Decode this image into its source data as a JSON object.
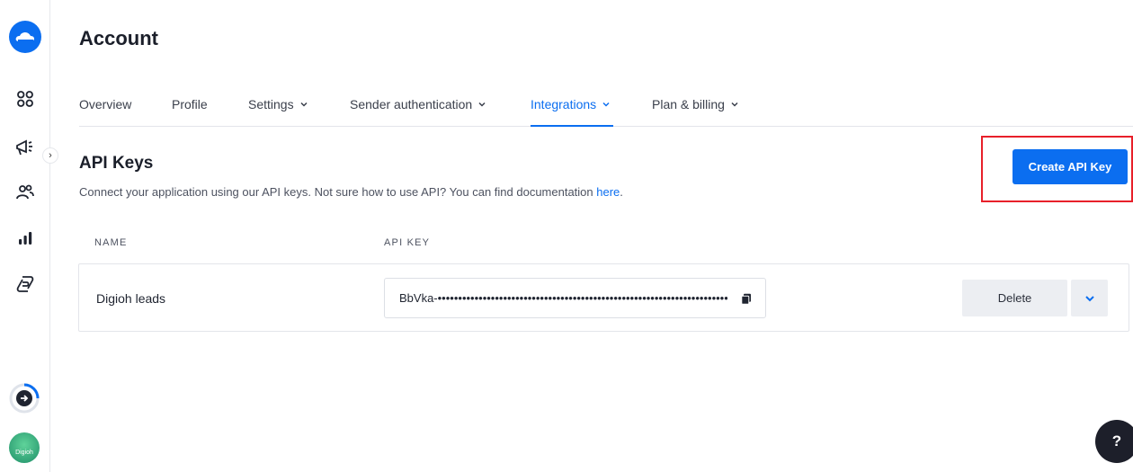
{
  "sidebar": {
    "logo_icon": "cloud-logo-icon",
    "items": [
      {
        "icon": "dashboard-grid-icon"
      },
      {
        "icon": "megaphone-icon"
      },
      {
        "icon": "contacts-icon"
      },
      {
        "icon": "statistics-icon"
      },
      {
        "icon": "automation-icon"
      }
    ],
    "expand_icon": "chevron-right-icon",
    "avatar_label": "Digioh"
  },
  "header": {
    "title": "Account"
  },
  "tabs": [
    {
      "label": "Overview",
      "has_dropdown": false,
      "active": false
    },
    {
      "label": "Profile",
      "has_dropdown": false,
      "active": false
    },
    {
      "label": "Settings",
      "has_dropdown": true,
      "active": false
    },
    {
      "label": "Sender authentication",
      "has_dropdown": true,
      "active": false
    },
    {
      "label": "Integrations",
      "has_dropdown": true,
      "active": true
    },
    {
      "label": "Plan & billing",
      "has_dropdown": true,
      "active": false
    }
  ],
  "api_keys": {
    "title": "API Keys",
    "description": "Connect your application using our API keys. Not sure how to use API? You can find documentation ",
    "doc_link": "here",
    "doc_link_suffix": ".",
    "create_button": "Create API Key",
    "columns": {
      "name": "NAME",
      "api_key": "API KEY"
    },
    "rows": [
      {
        "name": "Digioh leads",
        "api_key": "BbVka-••••••••••••••••••••••••••••••••••••••••••••••••••••••••••••••••••••••••••",
        "delete_label": "Delete"
      }
    ]
  },
  "help_button": "?",
  "colors": {
    "accent": "#0b6ef0",
    "highlight": "#e8202a"
  }
}
